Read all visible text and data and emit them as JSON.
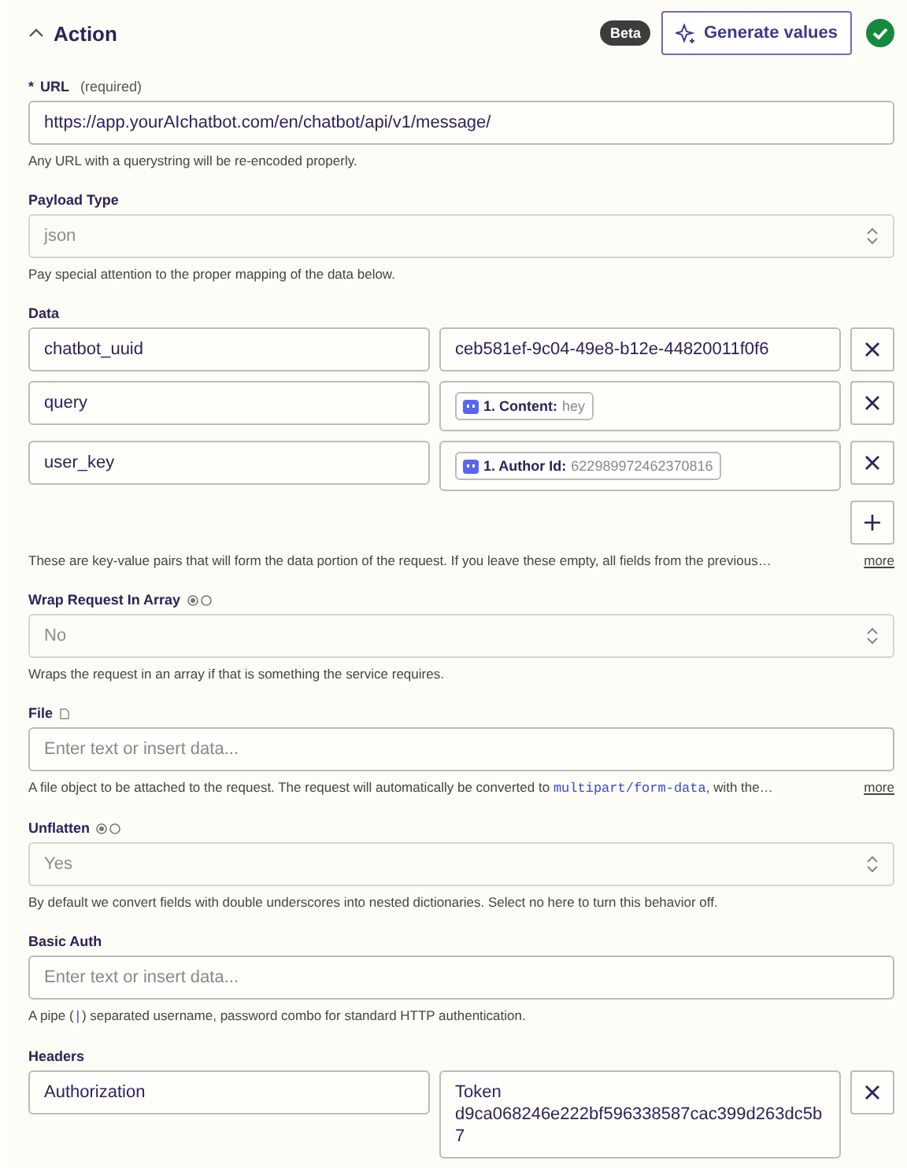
{
  "header": {
    "title": "Action",
    "expanded": true,
    "badge": "Beta",
    "button": "Generate values",
    "complete": true
  },
  "fields": [
    {
      "kind": "text",
      "label": "URL",
      "required_mark": "*",
      "note": "(required)",
      "value": "https://app.yourAIchatbot.com/en/chatbot/api/v1/message/",
      "hint": [
        {
          "kind": "text",
          "text": "Any URL with a querystring will be re-encoded properly."
        }
      ]
    },
    {
      "kind": "select",
      "label": "Payload Type",
      "value": "json",
      "hint": [
        {
          "kind": "text",
          "text": "Pay special attention to the proper mapping of the data below."
        }
      ]
    },
    {
      "kind": "pairs",
      "label": "Data",
      "rows": [
        {
          "key": "chatbot_uuid",
          "value": {
            "kind": "text",
            "text": "ceb581ef-9c04-49e8-b12e-44820011f0f6"
          }
        },
        {
          "key": "query",
          "value": {
            "kind": "pill",
            "name": "1. Content:",
            "text": "hey"
          }
        },
        {
          "key": "user_key",
          "value": {
            "kind": "pill",
            "name": "1. Author Id:",
            "text": "622989972462370816"
          }
        }
      ],
      "add": true,
      "hint": [
        {
          "kind": "text",
          "text": "These are key-value pairs that will form the data portion of the request. If you leave these empty, all fields from the previous…"
        }
      ],
      "more": "more"
    },
    {
      "kind": "select",
      "label": "Wrap Request In Array",
      "mode_icon": true,
      "value": "No",
      "hint": [
        {
          "kind": "text",
          "text": "Wraps the request in an array if that is something the service requires."
        }
      ]
    },
    {
      "kind": "text",
      "label": "File",
      "file_icon": true,
      "placeholder": "Enter text or insert data...",
      "hint": [
        {
          "kind": "text",
          "text": "A file object to be attached to the request. The request will automatically be converted to "
        },
        {
          "kind": "code",
          "text": "multipart/form-data"
        },
        {
          "kind": "text",
          "text": ", with the…"
        }
      ],
      "more": "more"
    },
    {
      "kind": "select",
      "label": "Unflatten",
      "mode_icon": true,
      "value": "Yes",
      "hint": [
        {
          "kind": "text",
          "text": "By default we convert fields with double underscores into nested dictionaries. Select no here to turn this behavior off."
        }
      ]
    },
    {
      "kind": "text",
      "label": "Basic Auth",
      "placeholder": "Enter text or insert data...",
      "hint": [
        {
          "kind": "text",
          "text": "A pipe ("
        },
        {
          "kind": "code",
          "text": "|"
        },
        {
          "kind": "text",
          "text": ") separated username, password combo for standard HTTP authentication."
        }
      ]
    },
    {
      "kind": "pairs",
      "label": "Headers",
      "rows": [
        {
          "key": "Authorization",
          "value": {
            "kind": "text",
            "text": "Token d9ca068246e222bf596338587cac399d263dc5b7"
          }
        }
      ],
      "add": false
    }
  ]
}
